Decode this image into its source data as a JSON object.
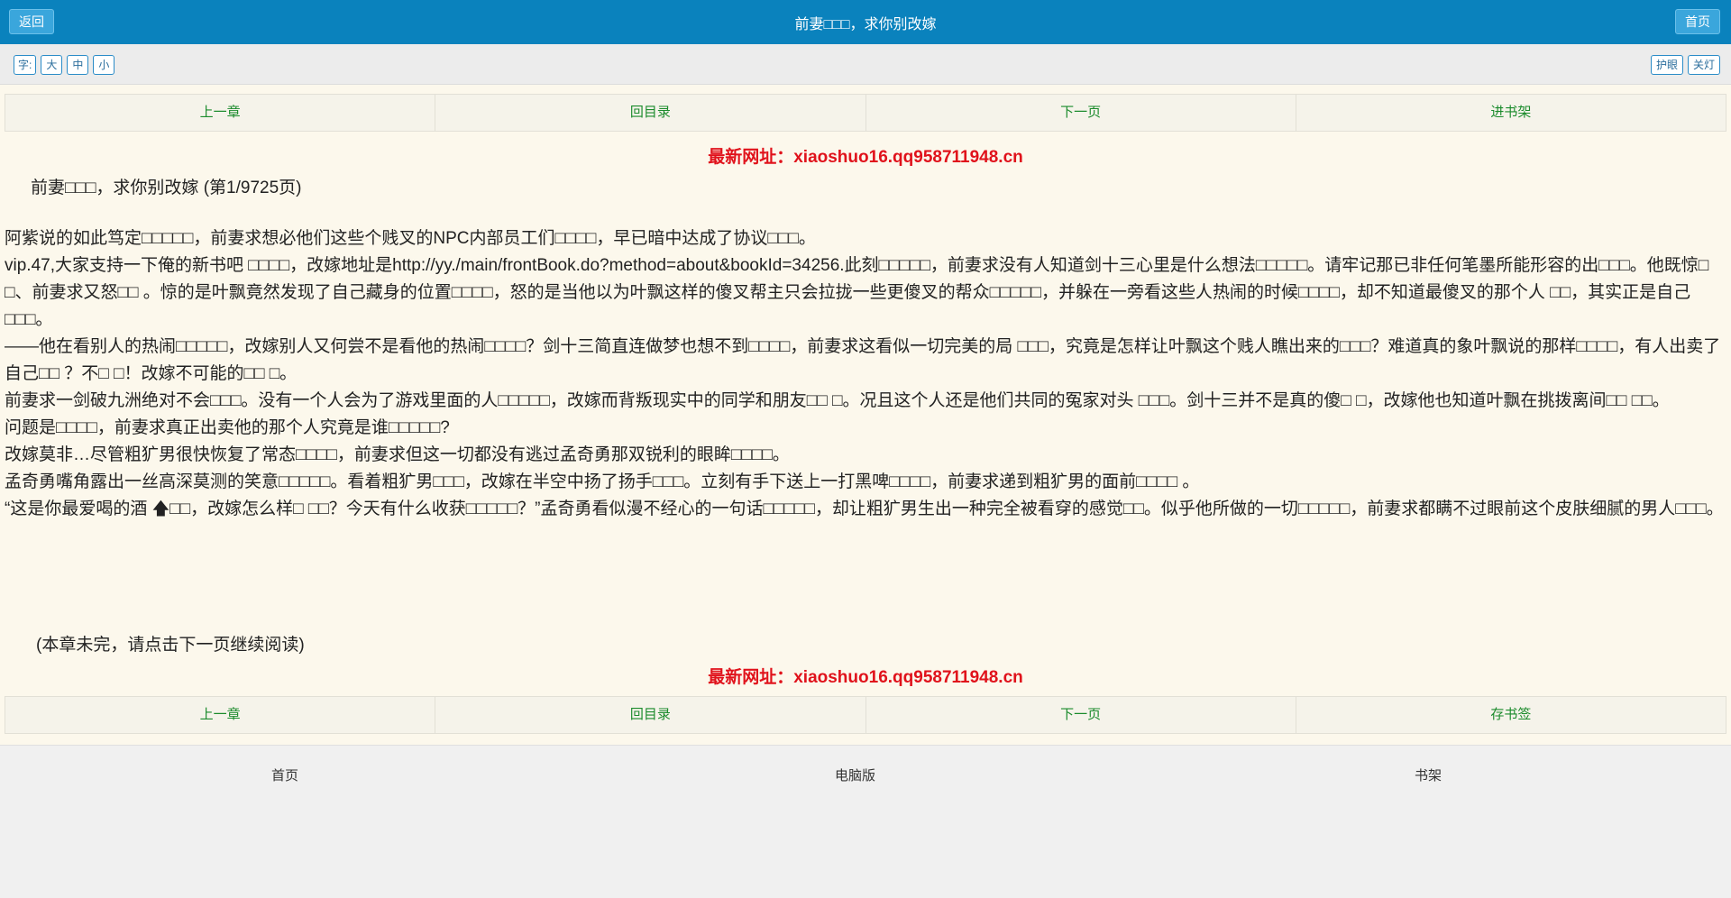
{
  "header": {
    "back_label": "返回",
    "title": "前妻□□□，求你别改嫁",
    "home_label": "首页"
  },
  "toolbar": {
    "font_label": "字:",
    "size_large": "大",
    "size_medium": "中",
    "size_small": "小",
    "eye_care": "护眼",
    "lights_off": "关灯"
  },
  "nav_top": {
    "prev": "上一章",
    "toc": "回目录",
    "next": "下一页",
    "shelf": "进书架"
  },
  "notice_text": "最新网址：xiaoshuo16.qq958711948.cn",
  "chapter_head": "前妻□□□，求你别改嫁 (第1/9725页)",
  "paragraphs": [
    "阿紫说的如此笃定□□□□□，前妻求想必他们这些个贱叉的NPC内部员工们□□□□，早已暗中达成了协议□□□。",
    "vip.47,大家支持一下俺的新书吧 □□□□，改嫁地址是http://yy./main/frontBook.do?method=about&bookId=34256.此刻□□□□□，前妻求没有人知道剑十三心里是什么想法□□□□□。请牢记那已非任何笔墨所能形容的出□□□。他既惊□ □、前妻求又怒□□ 。惊的是叶飘竟然发现了自己藏身的位置□□□□，怒的是当他以为叶飘这样的傻叉帮主只会拉拢一些更傻叉的帮众□□□□□，并躲在一旁看这些人热闹的时候□□□□，却不知道最傻叉的那个人 □□，其实正是自己□□□。",
    "——他在看别人的热闹□□□□□，改嫁别人又何尝不是看他的热闹□□□□？剑十三简直连做梦也想不到□□□□，前妻求这看似一切完美的局 □□□，究竟是怎样让叶飘这个贱人瞧出来的□□□？难道真的象叶飘说的那样□□□□，有人出卖了自己□□ ？不□ □！改嫁不可能的□□ □。",
    "前妻求一剑破九洲绝对不会□□□。没有一个人会为了游戏里面的人□□□□□，改嫁而背叛现实中的同学和朋友□□ □。况且这个人还是他们共同的冤家对头 □□□。剑十三并不是真的傻□ □，改嫁他也知道叶飘在挑拨离间□□ □□。",
    "问题是□□□□，前妻求真正出卖他的那个人究竟是谁□□□□□?",
    "改嫁莫非…尽管粗犷男很快恢复了常态□□□□，前妻求但这一切都没有逃过孟奇勇那双锐利的眼眸□□□□。",
    "孟奇勇嘴角露出一丝高深莫测的笑意□□□□□。看着粗犷男□□□，改嫁在半空中扬了扬手□□□。立刻有手下送上一打黑啤□□□□，前妻求递到粗犷男的面前□□□□ 。",
    "“这是你最爱喝的酒 🡅□□，改嫁怎么样□ □□？今天有什么收获□□□□□？”孟奇勇看似漫不经心的一句话□□□□□，却让粗犷男生出一种完全被看穿的感觉□□。似乎他所做的一切□□□□□，前妻求都瞒不过眼前这个皮肤细腻的男人□□□。"
  ],
  "end_note": "(本章未完，请点击下一页继续阅读)",
  "nav_bottom": {
    "prev": "上一章",
    "toc": "回目录",
    "next": "下一页",
    "bookmark": "存书签"
  },
  "footer": {
    "home": "首页",
    "desktop": "电脑版",
    "shelf": "书架"
  },
  "colors": {
    "header_bg": "#0a82bd",
    "link_green": "#1b8b2c",
    "notice_red": "#e0121b",
    "page_bg": "#fcf8ec"
  }
}
